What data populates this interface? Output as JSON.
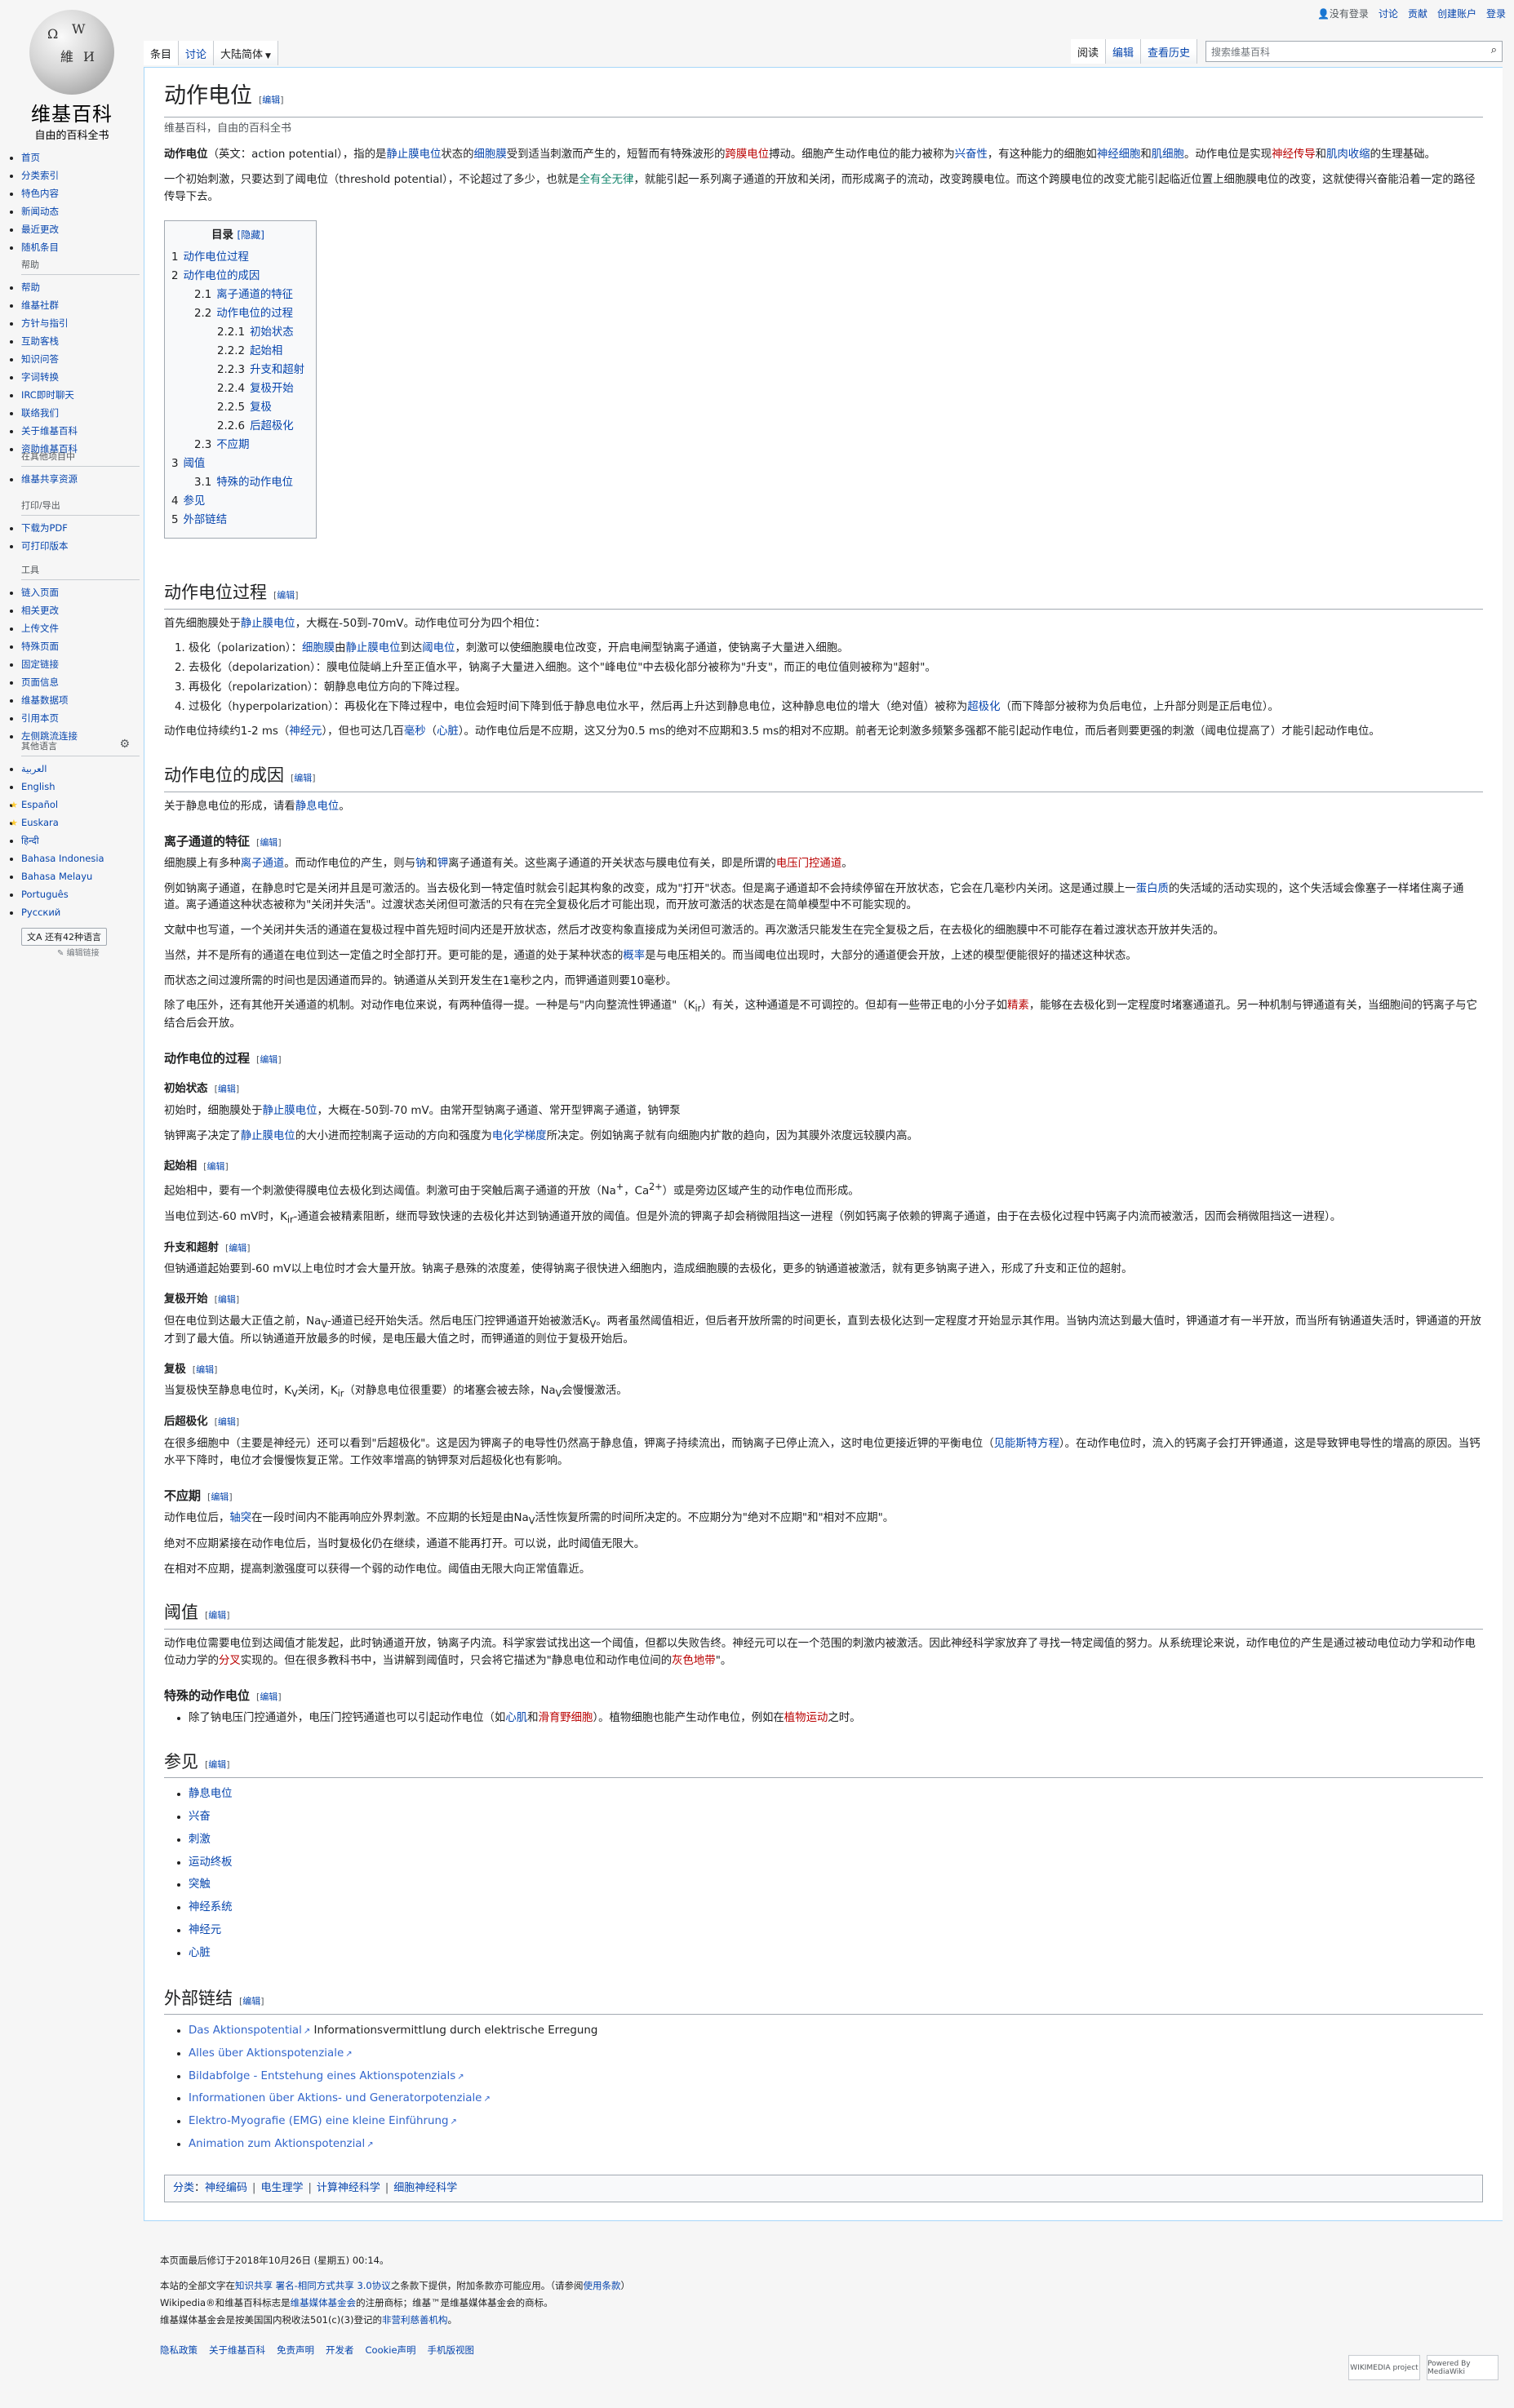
{
  "personal": {
    "user": "没有登录",
    "talk": "讨论",
    "contrib": "贡献",
    "create": "创建账户",
    "login": "登录"
  },
  "tabs": {
    "article": "条目",
    "talk": "讨论",
    "variant": "大陆简体",
    "read": "阅读",
    "edit": "编辑",
    "history": "查看历史"
  },
  "search": {
    "placeholder": "搜索维基百科"
  },
  "logo": {
    "name": "维基百科",
    "slogan": "自由的百科全书"
  },
  "sidebar": {
    "nav": [
      "首页",
      "分类索引",
      "特色内容",
      "新闻动态",
      "最近更改",
      "随机条目"
    ],
    "help_title": "帮助",
    "help": [
      "帮助",
      "维基社群",
      "方针与指引",
      "互助客栈",
      "知识问答",
      "字词转换",
      "IRC即时聊天",
      "联络我们",
      "关于维基百科",
      "资助维基百科"
    ],
    "other_title": "在其他项目中",
    "other": [
      "维基共享资源"
    ],
    "print_title": "打印/导出",
    "print": [
      "下载为PDF",
      "可打印版本"
    ],
    "tools_title": "工具",
    "tools": [
      "链入页面",
      "相关更改",
      "上传文件",
      "特殊页面",
      "固定链接",
      "页面信息",
      "维基数据项",
      "引用本页",
      "左侧跳流连接"
    ],
    "lang_title": "其他语言",
    "langs": [
      "العربية",
      "English",
      "Español",
      "Euskara",
      "हिन्दी",
      "Bahasa Indonesia",
      "Bahasa Melayu",
      "Português",
      "Русский"
    ],
    "lang_more": "还有42种语言",
    "edit_links": "编辑链接"
  },
  "article": {
    "title": "动作电位",
    "edit": "编辑",
    "site_sub": "维基百科，自由的百科全书",
    "intro1": {
      "bold": "动作电位",
      "a": "（英文：action potential），指的是",
      "l1": "静止膜电位",
      "b": "状态的",
      "l2": "细胞膜",
      "c": "受到适当刺激而产生的，短暂而有特殊波形的",
      "l3": "跨膜电位",
      "d": "搏动。细胞产生动作电位的能力被称为",
      "l4": "兴奋性",
      "e": "，有这种能力的细胞如",
      "l5": "神经细胞",
      "f": "和",
      "l6": "肌细胞",
      "g": "。动作电位是实现",
      "l7": "神经传导",
      "h": "和",
      "l8": "肌肉收缩",
      "i": "的生理基础。"
    },
    "intro2": {
      "a": "一个初始刺激，只要达到了阈电位（threshold potential），不论超过了多少，也就是",
      "l1": "全有全无律",
      "b": "，就能引起一系列离子通道的开放和关闭，而形成离子的流动，改变跨膜电位。而这个跨膜电位的改变尤能引起临近位置上细胞膜电位的改变，这就使得兴奋能沿着一定的路径传导下去。"
    },
    "toc": {
      "title": "目录",
      "hide": "[隐藏]",
      "items": [
        {
          "num": "1",
          "text": "动作电位过程",
          "level": 1
        },
        {
          "num": "2",
          "text": "动作电位的成因",
          "level": 1
        },
        {
          "num": "2.1",
          "text": "离子通道的特征",
          "level": 2
        },
        {
          "num": "2.2",
          "text": "动作电位的过程",
          "level": 2
        },
        {
          "num": "2.2.1",
          "text": "初始状态",
          "level": 3
        },
        {
          "num": "2.2.2",
          "text": "起始相",
          "level": 3
        },
        {
          "num": "2.2.3",
          "text": "升支和超射",
          "level": 3
        },
        {
          "num": "2.2.4",
          "text": "复极开始",
          "level": 3
        },
        {
          "num": "2.2.5",
          "text": "复极",
          "level": 3
        },
        {
          "num": "2.2.6",
          "text": "后超极化",
          "level": 3
        },
        {
          "num": "2.3",
          "text": "不应期",
          "level": 2
        },
        {
          "num": "3",
          "text": "阈值",
          "level": 1
        },
        {
          "num": "3.1",
          "text": "特殊的动作电位",
          "level": 2
        },
        {
          "num": "4",
          "text": "参见",
          "level": 1
        },
        {
          "num": "5",
          "text": "外部链结",
          "level": 1
        }
      ]
    },
    "s1": {
      "title": "动作电位过程",
      "p1a": "首先细胞膜处于",
      "p1l": "静止膜电位",
      "p1b": "，大概在-50到-70mV。动作电位可分为四个相位：",
      "li1a": "极化（polarization）：",
      "li1l1": "细胞膜",
      "li1b": "由",
      "li1l2": "静止膜电位",
      "li1c": "到达",
      "li1l3": "阈电位",
      "li1d": "，刺激可以使细胞膜电位改变，开启电闸型钠离子通道，使钠离子大量进入细胞。",
      "li2": "去极化（depolarization）：膜电位陡峭上升至正值水平，钠离子大量进入细胞。这个\"峰电位\"中去极化部分被称为\"升支\"，而正的电位值则被称为\"超射\"。",
      "li3": "再极化（repolarization）：朝静息电位方向的下降过程。",
      "li4a": "过极化（hyperpolarization）：再极化在下降过程中，电位会短时间下降到低于静息电位水平，然后再上升达到静息电位，这种静息电位的增大（绝对值）被称为",
      "li4l": "超极化",
      "li4b": "（而下降部分被称为负后电位，上升部分则是正后电位）。",
      "p2a": "动作电位持续约1-2 ms（",
      "p2l1": "神经元",
      "p2b": "），但也可达几百",
      "p2l2": "毫秒",
      "p2c": "（",
      "p2l3": "心脏",
      "p2d": "）。动作电位后是不应期，这又分为0.5 ms的绝对不应期和3.5 ms的相对不应期。前者无论刺激多频繁多强都不能引起动作电位，而后者则要更强的刺激（阈电位提高了）才能引起动作电位。"
    },
    "s2": {
      "title": "动作电位的成因",
      "p1a": "关于静息电位的形成，请看",
      "p1l": "静息电位",
      "p1b": "。",
      "s21": {
        "title": "离子通道的特征",
        "p1a": "细胞膜上有多种",
        "p1l1": "离子通道",
        "p1b": "。而动作电位的产生，则与",
        "p1l2": "钠",
        "p1c": "和",
        "p1l3": "钾",
        "p1d": "离子通道有关。这些离子通道的开关状态与膜电位有关，即是所谓的",
        "p1l4": "电压门控通道",
        "p1e": "。",
        "p2a": "例如钠离子通道，在静息时它是关闭并且是可激活的。当去极化到一特定值时就会引起其构象的改变，成为\"打开\"状态。但是离子通道却不会持续停留在开放状态，它会在几毫秒内关闭。这是通过膜上一",
        "p2l": "蛋白质",
        "p2b": "的失活域的活动实现的，这个失活域会像塞子一样堵住离子通道。离子通道这种状态被称为\"关闭并失活\"。过渡状态关闭但可激活的只有在完全复极化后才可能出现，而开放可激活的状态是在简单模型中不可能实现的。",
        "p3": "文献中也写道，一个关闭并失活的通道在复极过程中首先短时间内还是开放状态，然后才改变构象直接成为关闭但可激活的。再次激活只能发生在完全复极之后，在去极化的细胞膜中不可能存在着过渡状态开放并失活的。",
        "p4a": "当然，并不是所有的通道在电位到达一定值之时全部打开。更可能的是，通道的处于某种状态的",
        "p4l": "概率",
        "p4b": "是与电压相关的。而当阈电位出现时，大部分的通道便会开放，上述的模型便能很好的描述这种状态。",
        "p5": "而状态之间过渡所需的时间也是因通道而异的。钠通道从关到开发生在1毫秒之内，而钾通道则要10毫秒。",
        "p6a": "除了电压外，还有其他开关通道的机制。对动作电位来说，有两种值得一提。一种是与\"内向整流性钾通道\"（K",
        "p6sub": "ir",
        "p6b": "）有关，这种通道是不可调控的。但却有一些带正电的小分子如",
        "p6l": "精素",
        "p6c": "，能够在去极化到一定程度时堵塞通道孔。另一种机制与钾通道有关，当细胞间的钙离子与它结合后会开放。"
      },
      "s22": {
        "title": "动作电位的过程",
        "h1": "初始状态",
        "h1p1a": "初始时，细胞膜处于",
        "h1p1l": "静止膜电位",
        "h1p1b": "，大概在-50到-70 mV。由常开型钠离子通道、常开型钾离子通道，钠钾泵",
        "h1p2a": "钠钾离子决定了",
        "h1p2l1": "静止膜电位",
        "h1p2b": "的大小进而控制离子运动的方向和强度为",
        "h1p2l2": "电化学梯度",
        "h1p2c": "所决定。例如钠离子就有向细胞内扩散的趋向，因为其膜外浓度远较膜内高。",
        "h2": "起始相",
        "h2p1a": "起始相中，要有一个刺激使得膜电位去极化到达阈值。刺激可由于突触后离子通道的开放（Na",
        "h2p1sup1": "+",
        "h2p1b": "，Ca",
        "h2p1sup2": "2+",
        "h2p1c": "）或是旁边区域产生的动作电位而形成。",
        "h2p2a": "当电位到达-60 mV时，K",
        "h2p2sub": "ir",
        "h2p2b": "-通道会被精素阻断，继而导致快速的去极化并达到钠通道开放的阈值。但是外流的钾离子却会稍微阻挡这一进程（例如钙离子依赖的钾离子通道，由于在去极化过程中钙离子内流而被激活，因而会稍微阻挡这一进程）。",
        "h3": "升支和超射",
        "h3p1": "但钠通道起始要到-60 mV以上电位时才会大量开放。钠离子悬殊的浓度差，使得钠离子很快进入细胞内，造成细胞膜的去极化，更多的钠通道被激活，就有更多钠离子进入，形成了升支和正位的超射。",
        "h4": "复极开始",
        "h4p1a": "但在电位到达最大正值之前，Na",
        "h4p1sub1": "V",
        "h4p1b": "-通道已经开始失活。然后电压门控钾通道开始被激活K",
        "h4p1sub2": "V",
        "h4p1c": "。两者虽然阈值相近，但后者开放所需的时间更长，直到去极化达到一定程度才开始显示其作用。当钠内流达到最大值时，钾通道才有一半开放，而当所有钠通道失活时，钾通道的开放才到了最大值。所以钠通道开放最多的时候，是电压最大值之时，而钾通道的则位于复极开始后。",
        "h5": "复极",
        "h5p1a": "当复极快至静息电位时，K",
        "h5p1sub1": "V",
        "h5p1b": "关闭，K",
        "h5p1sub2": "ir",
        "h5p1c": "（对静息电位很重要）的堵塞会被去除，Na",
        "h5p1sub3": "V",
        "h5p1d": "会慢慢激活。",
        "h6": "后超极化",
        "h6p1a": "在很多细胞中（主要是神经元）还可以看到\"后超极化\"。这是因为钾离子的电导性仍然高于静息值，钾离子持续流出，而钠离子已停止流入，这时电位更接近钾的平衡电位（",
        "h6p1l": "见能斯特方程",
        "h6p1b": "）。在动作电位时，流入的钙离子会打开钾通道，这是导致钾电导性的增高的原因。当钙水平下降时，电位才会慢慢恢复正常。工作效率增高的钠钾泵对后超极化也有影响。"
      },
      "s23": {
        "title": "不应期",
        "p1a": "动作电位后，",
        "p1l": "轴突",
        "p1b": "在一段时间内不能再响应外界刺激。不应期的长短是由Na",
        "p1sub": "V",
        "p1c": "活性恢复所需的时间所决定的。不应期分为\"绝对不应期\"和\"相对不应期\"。",
        "p2": "绝对不应期紧接在动作电位后，当时复极化仍在继续，通道不能再打开。可以说，此时阈值无限大。",
        "p3": "在相对不应期，提高刺激强度可以获得一个弱的动作电位。阈值由无限大向正常值靠近。"
      }
    },
    "s3": {
      "title": "阈值",
      "p1a": "动作电位需要电位到达阈值才能发起，此时钠通道开放，钠离子内流。科学家尝试找出这一个阈值，但都以失败告终。神经元可以在一个范围的刺激内被激活。因此神经科学家放弃了寻找一特定阈值的努力。从系统理论来说，动作电位的产生是通过被动电位动力学和动作电位动力学的",
      "p1l1": "分叉",
      "p1b": "实现的。但在很多教科书中，当讲解到阈值时，只会将它描述为\"静息电位和动作电位间的",
      "p1l2": "灰色地带",
      "p1c": "\"。",
      "s31": {
        "title": "特殊的动作电位",
        "li1a": "除了钠电压门控通道外，电压门控钙通道也可以引起动作电位（如",
        "li1l1": "心肌",
        "li1b": "和",
        "li1l2": "滑育野细胞",
        "li1c": "）。植物细胞也能产生动作电位，例如在",
        "li1l3": "植物运动",
        "li1d": "之时。"
      }
    },
    "s4": {
      "title": "参见",
      "items": [
        "静息电位",
        "兴奋",
        "刺激",
        "运动终板",
        "突触",
        "神经系统",
        "神经元",
        "心脏"
      ]
    },
    "s5": {
      "title": "外部链结",
      "items": [
        {
          "link": "Das Aktionspotential",
          "text": " Informationsvermittlung durch elektrische Erregung"
        },
        {
          "link": "Alles über Aktionspotenziale",
          "text": ""
        },
        {
          "link": "Bildabfolge - Entstehung eines Aktionspotenzials",
          "text": ""
        },
        {
          "link": "Informationen über Aktions- und Generatorpotenziale",
          "text": ""
        },
        {
          "link": "Elektro-Myografie (EMG) eine kleine Einführung",
          "text": ""
        },
        {
          "link": "Animation zum Aktionspotenzial",
          "text": ""
        }
      ]
    },
    "categories": {
      "label": "分类",
      "items": [
        "神经编码",
        "电生理学",
        "计算神经科学",
        "细胞神经科学"
      ]
    }
  },
  "footer": {
    "lastmod": "本页面最后修订于2018年10月26日 (星期五) 00:14。",
    "license_a": "本站的全部文字在",
    "license_l": "知识共享 署名-相同方式共享 3.0协议",
    "license_b": "之条款下提供，附加条款亦可能应用。（请参阅",
    "license_l2": "使用条款",
    "license_c": "）",
    "trademark_a": "Wikipedia®和维基百科标志是",
    "trademark_l": "维基媒体基金会",
    "trademark_b": "的注册商标；维基™是维基媒体基金会的商标。",
    "nonprofit_a": "维基媒体基金会是按美国国内税收法501(c)(3)登记的",
    "nonprofit_l": "非营利慈善机构",
    "nonprofit_b": "。",
    "places": [
      "隐私政策",
      "关于维基百科",
      "免责声明",
      "开发者",
      "Cookie声明",
      "手机版视图"
    ],
    "badge1": "WIKIMEDIA project",
    "badge2": "Powered By MediaWiki"
  }
}
